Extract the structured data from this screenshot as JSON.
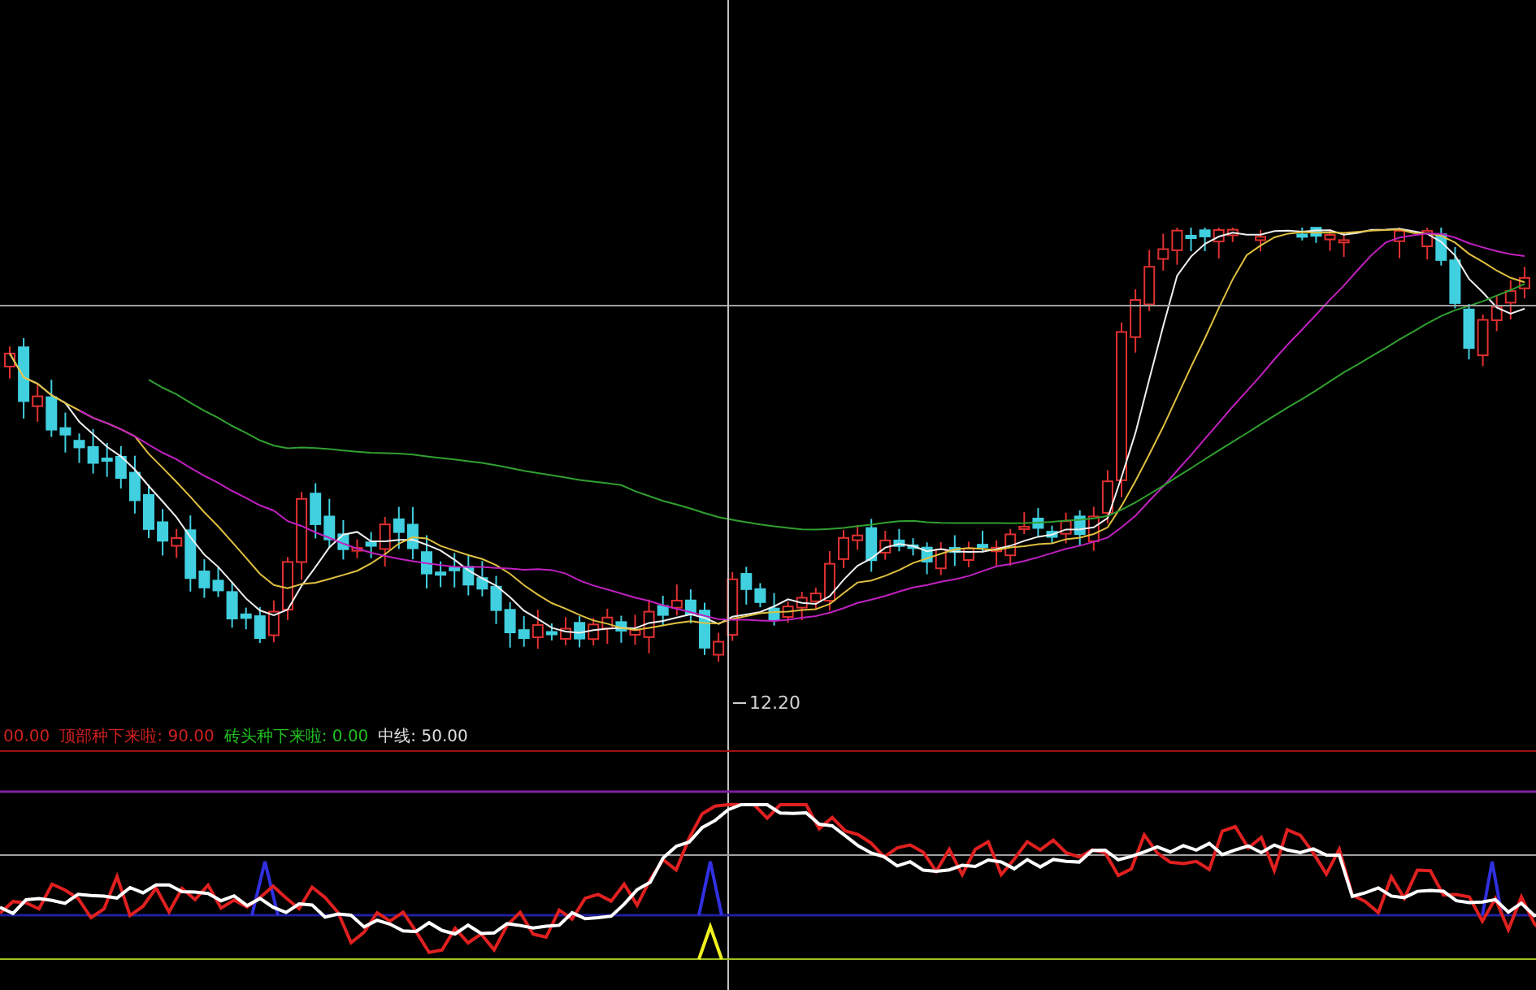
{
  "price_chart": {
    "low_label": "12.20"
  },
  "indicator_legend": [
    {
      "value": "00.00",
      "color": "#d02020"
    },
    {
      "name": "顶部种下来啦:",
      "value": "90.00",
      "color": "#d02020"
    },
    {
      "name": "砖头种下来啦:",
      "value": "0.00",
      "color": "#20c020"
    },
    {
      "name": "中线:",
      "value": "50.00",
      "color": "#e0e0e0"
    }
  ]
}
